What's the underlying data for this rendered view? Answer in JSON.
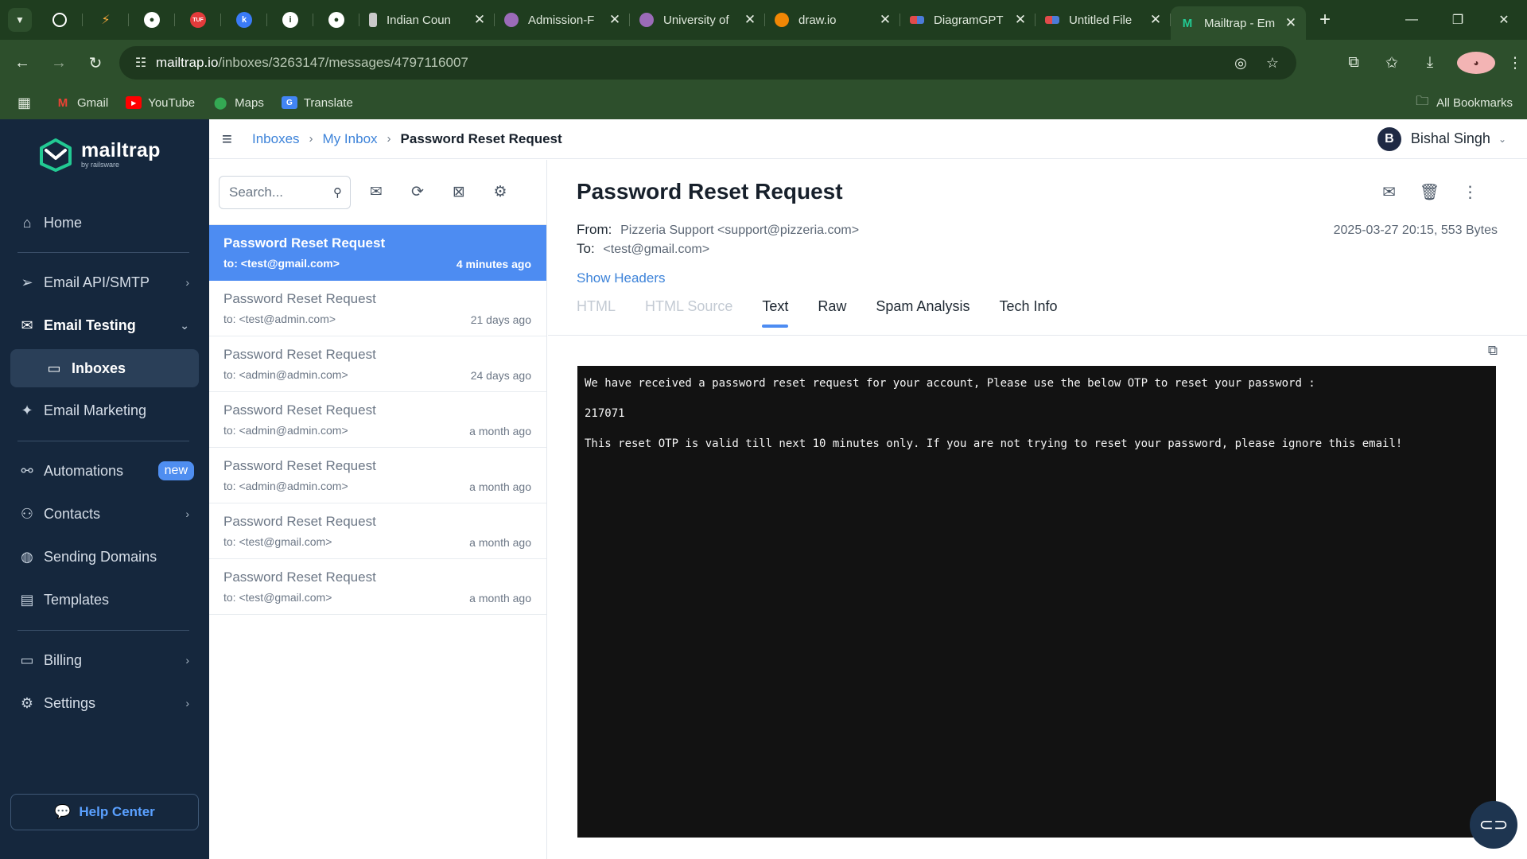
{
  "browser": {
    "pinned_tabs": [
      {
        "icon": "chrome-logo-icon",
        "color": "#ffffff"
      },
      {
        "icon": "script-icon",
        "color": "#f4a63a"
      },
      {
        "icon": "github-icon",
        "color": "#ffffff"
      },
      {
        "icon": "tuf-icon",
        "color": "#e33b3b"
      },
      {
        "icon": "k-icon",
        "color": "#3a7bf7"
      },
      {
        "icon": "info-icon",
        "color": "#ffffff"
      },
      {
        "icon": "github-icon",
        "color": "#ffffff"
      }
    ],
    "tabs": [
      {
        "title": "Indian Coun",
        "icon": "emblem-icon",
        "color": "#c9c9c9"
      },
      {
        "title": "Admission-F",
        "icon": "university-icon",
        "color": "#9b6bb8"
      },
      {
        "title": "University of",
        "icon": "university-icon",
        "color": "#9b6bb8"
      },
      {
        "title": "draw.io",
        "icon": "drawio-icon",
        "color": "#f08705"
      },
      {
        "title": "DiagramGPT",
        "icon": "eraser-icon",
        "color": "#e14b4b"
      },
      {
        "title": "Untitled File",
        "icon": "eraser-icon",
        "color": "#e14b4b"
      },
      {
        "title": "Mailtrap - Em",
        "icon": "mailtrap-icon",
        "color": "#22c993",
        "active": true
      }
    ],
    "url_host": "mailtrap.io",
    "url_path": "/inboxes/3263147/messages/4797116007",
    "bookmarks": [
      {
        "label": "Gmail",
        "icon": "gmail-icon",
        "color": "#ea4335"
      },
      {
        "label": "YouTube",
        "icon": "youtube-icon",
        "color": "#ff0000"
      },
      {
        "label": "Maps",
        "icon": "maps-icon",
        "color": "#34a853"
      },
      {
        "label": "Translate",
        "icon": "translate-icon",
        "color": "#4285f4"
      }
    ],
    "all_bookmarks": "All Bookmarks"
  },
  "sidebar": {
    "logo_name": "mailtrap",
    "logo_by": "by railsware",
    "items": {
      "home": "Home",
      "email_api": "Email API/SMTP",
      "email_testing": "Email Testing",
      "inboxes": "Inboxes",
      "email_marketing": "Email Marketing",
      "automations": "Automations",
      "automations_badge": "new",
      "contacts": "Contacts",
      "sending_domains": "Sending Domains",
      "templates": "Templates",
      "billing": "Billing",
      "settings": "Settings"
    },
    "help_center": "Help Center"
  },
  "appbar": {
    "breadcrumbs": [
      "Inboxes",
      "My Inbox",
      "Password Reset Request"
    ],
    "user_initial": "B",
    "user_name": "Bishal Singh"
  },
  "list": {
    "search_placeholder": "Search...",
    "messages": [
      {
        "subject": "Password Reset Request",
        "to": "to: <test@gmail.com>",
        "ago": "4 minutes ago",
        "selected": true
      },
      {
        "subject": "Password Reset Request",
        "to": "to: <test@admin.com>",
        "ago": "21 days ago"
      },
      {
        "subject": "Password Reset Request",
        "to": "to: <admin@admin.com>",
        "ago": "24 days ago"
      },
      {
        "subject": "Password Reset Request",
        "to": "to: <admin@admin.com>",
        "ago": "a month ago"
      },
      {
        "subject": "Password Reset Request",
        "to": "to: <admin@admin.com>",
        "ago": "a month ago"
      },
      {
        "subject": "Password Reset Request",
        "to": "to: <test@gmail.com>",
        "ago": "a month ago"
      },
      {
        "subject": "Password Reset Request",
        "to": "to: <test@gmail.com>",
        "ago": "a month ago"
      }
    ]
  },
  "detail": {
    "title": "Password Reset Request",
    "from_label": "From:",
    "from_value": "Pizzeria Support <support@pizzeria.com>",
    "to_label": "To:",
    "to_value": "<test@gmail.com>",
    "date_size": "2025-03-27 20:15, 553 Bytes",
    "show_headers": "Show Headers",
    "tabs": [
      "HTML",
      "HTML Source",
      "Text",
      "Raw",
      "Spam Analysis",
      "Tech Info"
    ],
    "active_tab": "Text",
    "body_lines": [
      "We have received a password reset request for your account, Please use the below OTP to reset your password :",
      "217071",
      "This reset OTP is valid till next 10 minutes only. If you are not trying to reset your password, please ignore this email!"
    ]
  },
  "colors": {
    "accent": "#4d8cf2",
    "sidebar_bg": "#15273d",
    "browser_frame": "#2d4f2c",
    "mailtrap_green": "#22c993"
  }
}
